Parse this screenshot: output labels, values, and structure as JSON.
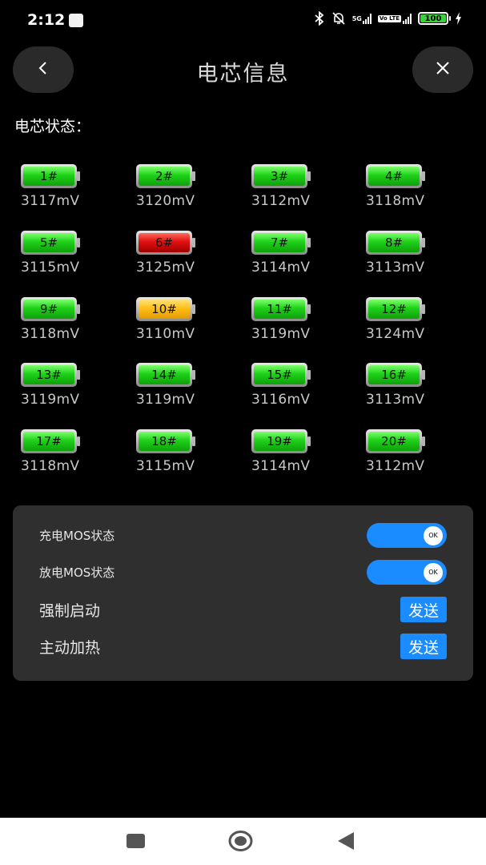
{
  "status_bar": {
    "time": "2:12",
    "network_label": "5G",
    "volte_label": "Vo LTE",
    "battery_level": "100",
    "icons": [
      "notification-icon",
      "bluetooth-icon",
      "mute-icon",
      "signal-icon",
      "volte-icon",
      "battery-icon",
      "charging-icon"
    ]
  },
  "header": {
    "title": "电芯信息",
    "back_icon": "chevron-left-icon",
    "close_icon": "close-icon"
  },
  "cells_section": {
    "label": "电芯状态："
  },
  "cells": [
    {
      "label": "1#",
      "voltage": "3117mV",
      "status": "green"
    },
    {
      "label": "2#",
      "voltage": "3120mV",
      "status": "green"
    },
    {
      "label": "3#",
      "voltage": "3112mV",
      "status": "green"
    },
    {
      "label": "4#",
      "voltage": "3118mV",
      "status": "green"
    },
    {
      "label": "5#",
      "voltage": "3115mV",
      "status": "green"
    },
    {
      "label": "6#",
      "voltage": "3125mV",
      "status": "red"
    },
    {
      "label": "7#",
      "voltage": "3114mV",
      "status": "green"
    },
    {
      "label": "8#",
      "voltage": "3113mV",
      "status": "green"
    },
    {
      "label": "9#",
      "voltage": "3118mV",
      "status": "green"
    },
    {
      "label": "10#",
      "voltage": "3110mV",
      "status": "yellow"
    },
    {
      "label": "11#",
      "voltage": "3119mV",
      "status": "green"
    },
    {
      "label": "12#",
      "voltage": "3124mV",
      "status": "green"
    },
    {
      "label": "13#",
      "voltage": "3119mV",
      "status": "green"
    },
    {
      "label": "14#",
      "voltage": "3119mV",
      "status": "green"
    },
    {
      "label": "15#",
      "voltage": "3116mV",
      "status": "green"
    },
    {
      "label": "16#",
      "voltage": "3113mV",
      "status": "green"
    },
    {
      "label": "17#",
      "voltage": "3118mV",
      "status": "green"
    },
    {
      "label": "18#",
      "voltage": "3115mV",
      "status": "green"
    },
    {
      "label": "19#",
      "voltage": "3114mV",
      "status": "green"
    },
    {
      "label": "20#",
      "voltage": "3112mV",
      "status": "green"
    }
  ],
  "controls": {
    "charge_mos": {
      "label": "充电MOS状态",
      "state": "OK"
    },
    "discharge_mos": {
      "label": "放电MOS状态",
      "state": "OK"
    },
    "force_start": {
      "label": "强制启动",
      "button": "发送"
    },
    "active_heating": {
      "label": "主动加热",
      "button": "发送"
    }
  },
  "colors": {
    "accent": "#1a8cff",
    "cell_ok": "#1fd21a",
    "cell_high": "#e01010",
    "cell_low": "#ffbf1a",
    "panel_bg": "#2f2f2f"
  },
  "nav_bar": {
    "icons": [
      "recents-square-icon",
      "home-circle-icon",
      "back-triangle-icon"
    ]
  }
}
